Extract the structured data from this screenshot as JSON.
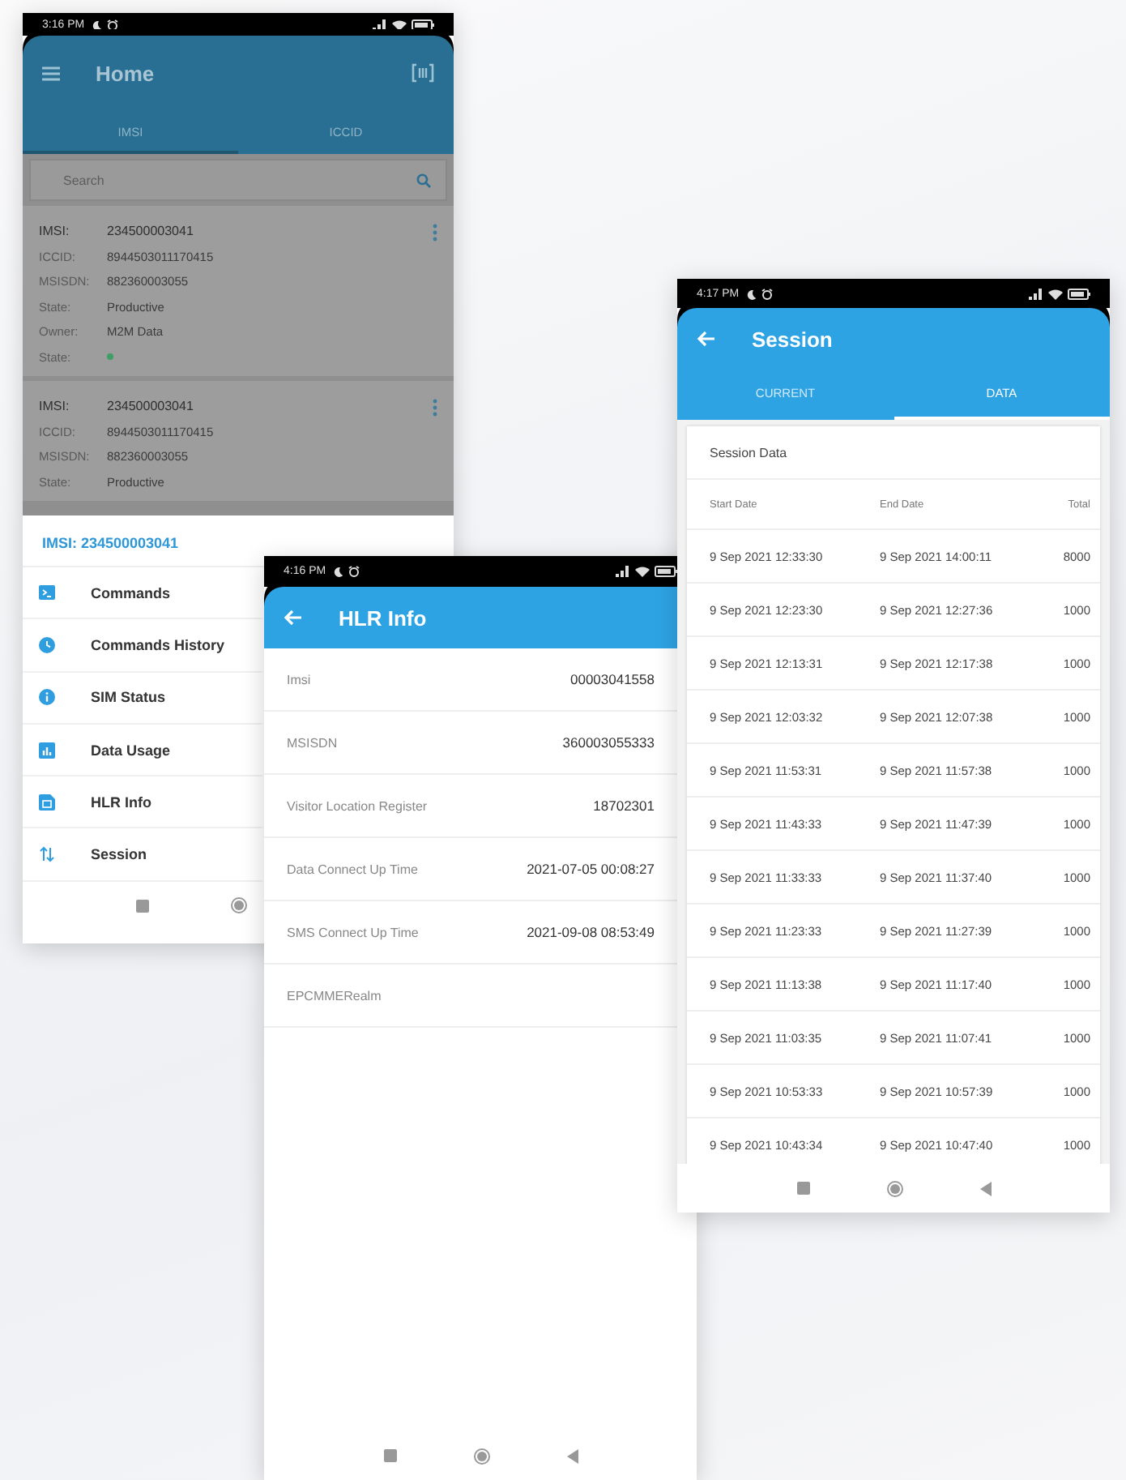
{
  "home_screen": {
    "status_time": "3:16 PM",
    "title": "Home",
    "tabs": [
      {
        "label": "IMSI",
        "selected": true
      },
      {
        "label": "ICCID",
        "selected": false
      }
    ],
    "search": {
      "placeholder": "Search"
    },
    "cards": [
      {
        "fields": [
          {
            "kind": "text",
            "label": "IMSI:",
            "value": "234500003041"
          },
          {
            "kind": "text",
            "label": "ICCID:",
            "value": "8944503011170415"
          },
          {
            "kind": "text",
            "label": "MSISDN:",
            "value": "882360003055"
          },
          {
            "kind": "text",
            "label": "State:",
            "value": "Productive"
          },
          {
            "kind": "text",
            "label": "Owner:",
            "value": "M2M Data"
          },
          {
            "kind": "status",
            "label": "State:",
            "color": "#3f9e66"
          }
        ]
      },
      {
        "fields": [
          {
            "kind": "text",
            "label": "IMSI:",
            "value": "234500003041"
          },
          {
            "kind": "text",
            "label": "ICCID:",
            "value": "8944503011170415"
          },
          {
            "kind": "text",
            "label": "MSISDN:",
            "value": "882360003055"
          },
          {
            "kind": "text",
            "label": "State:",
            "value": "Productive"
          }
        ]
      }
    ],
    "sheet": {
      "title": "IMSI: 234500003041",
      "items": [
        {
          "kind": "commands",
          "label": "Commands"
        },
        {
          "kind": "history",
          "label": "Commands History"
        },
        {
          "kind": "info",
          "label": "SIM Status"
        },
        {
          "kind": "chart",
          "label": "Data Usage"
        },
        {
          "kind": "sim",
          "label": "HLR Info"
        },
        {
          "kind": "arrows",
          "label": "Session"
        }
      ]
    }
  },
  "hlr_screen": {
    "status_time": "4:16 PM",
    "title": "HLR Info",
    "rows": [
      {
        "label": "Imsi",
        "value": "00003041558"
      },
      {
        "label": "MSISDN",
        "value": "360003055333"
      },
      {
        "label": "Visitor Location Register",
        "value": "18702301"
      },
      {
        "label": "Data Connect Up Time",
        "value": "2021-07-05 00:08:27"
      },
      {
        "label": "SMS Connect Up Time",
        "value": "2021-09-08 08:53:49"
      },
      {
        "label": "EPCMMERealm"
      }
    ]
  },
  "session_screen": {
    "status_time": "4:17 PM",
    "title": "Session",
    "tabs": [
      {
        "label": "CURRENT",
        "selected": false
      },
      {
        "label": "DATA",
        "selected": true
      }
    ],
    "card_title": "Session Data",
    "table": {
      "columns": [
        "Start Date",
        "End Date",
        "Total"
      ],
      "rows": [
        [
          "9 Sep 2021 12:33:30",
          "9 Sep 2021 14:00:11",
          "8000"
        ],
        [
          "9 Sep 2021 12:23:30",
          "9 Sep 2021 12:27:36",
          "1000"
        ],
        [
          "9 Sep 2021 12:13:31",
          "9 Sep 2021 12:17:38",
          "1000"
        ],
        [
          "9 Sep 2021 12:03:32",
          "9 Sep 2021 12:07:38",
          "1000"
        ],
        [
          "9 Sep 2021 11:53:31",
          "9 Sep 2021 11:57:38",
          "1000"
        ],
        [
          "9 Sep 2021 11:43:33",
          "9 Sep 2021 11:47:39",
          "1000"
        ],
        [
          "9 Sep 2021 11:33:33",
          "9 Sep 2021 11:37:40",
          "1000"
        ],
        [
          "9 Sep 2021 11:23:33",
          "9 Sep 2021 11:27:39",
          "1000"
        ],
        [
          "9 Sep 2021 11:13:38",
          "9 Sep 2021 11:17:40",
          "1000"
        ],
        [
          "9 Sep 2021 11:03:35",
          "9 Sep 2021 11:07:41",
          "1000"
        ],
        [
          "9 Sep 2021 10:53:33",
          "9 Sep 2021 10:57:39",
          "1000"
        ],
        [
          "9 Sep 2021 10:43:34",
          "9 Sep 2021 10:47:40",
          "1000"
        ]
      ]
    }
  }
}
